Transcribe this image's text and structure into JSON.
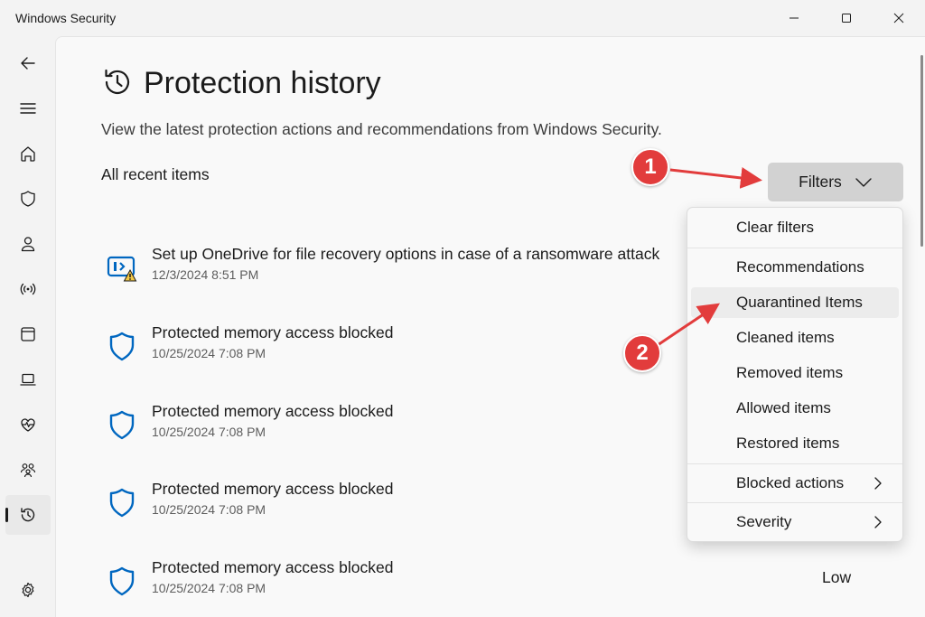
{
  "window": {
    "title": "Windows Security"
  },
  "page": {
    "title": "Protection history",
    "description": "View the latest protection actions and recommendations from Windows Security.",
    "section_label": "All recent items"
  },
  "items": [
    {
      "title": "Set up OneDrive for file recovery options in case of a ransomware attack",
      "date": "12/3/2024 8:51 PM",
      "icon": "onedrive-warning-icon"
    },
    {
      "title": "Protected memory access blocked",
      "date": "10/25/2024 7:08 PM",
      "icon": "shield-icon"
    },
    {
      "title": "Protected memory access blocked",
      "date": "10/25/2024 7:08 PM",
      "icon": "shield-icon"
    },
    {
      "title": "Protected memory access blocked",
      "date": "10/25/2024 7:08 PM",
      "icon": "shield-icon"
    },
    {
      "title": "Protected memory access blocked",
      "date": "10/25/2024 7:08 PM",
      "icon": "shield-icon"
    }
  ],
  "last_item_severity": "Low",
  "filters": {
    "label": "Filters",
    "menu": {
      "clear": "Clear filters",
      "items": [
        "Recommendations",
        "Quarantined Items",
        "Cleaned items",
        "Removed items",
        "Allowed items",
        "Restored items"
      ],
      "blocked_actions": "Blocked actions",
      "severity": "Severity"
    }
  },
  "annotations": {
    "step1": "1",
    "step2": "2",
    "color": "#e23c3c"
  }
}
